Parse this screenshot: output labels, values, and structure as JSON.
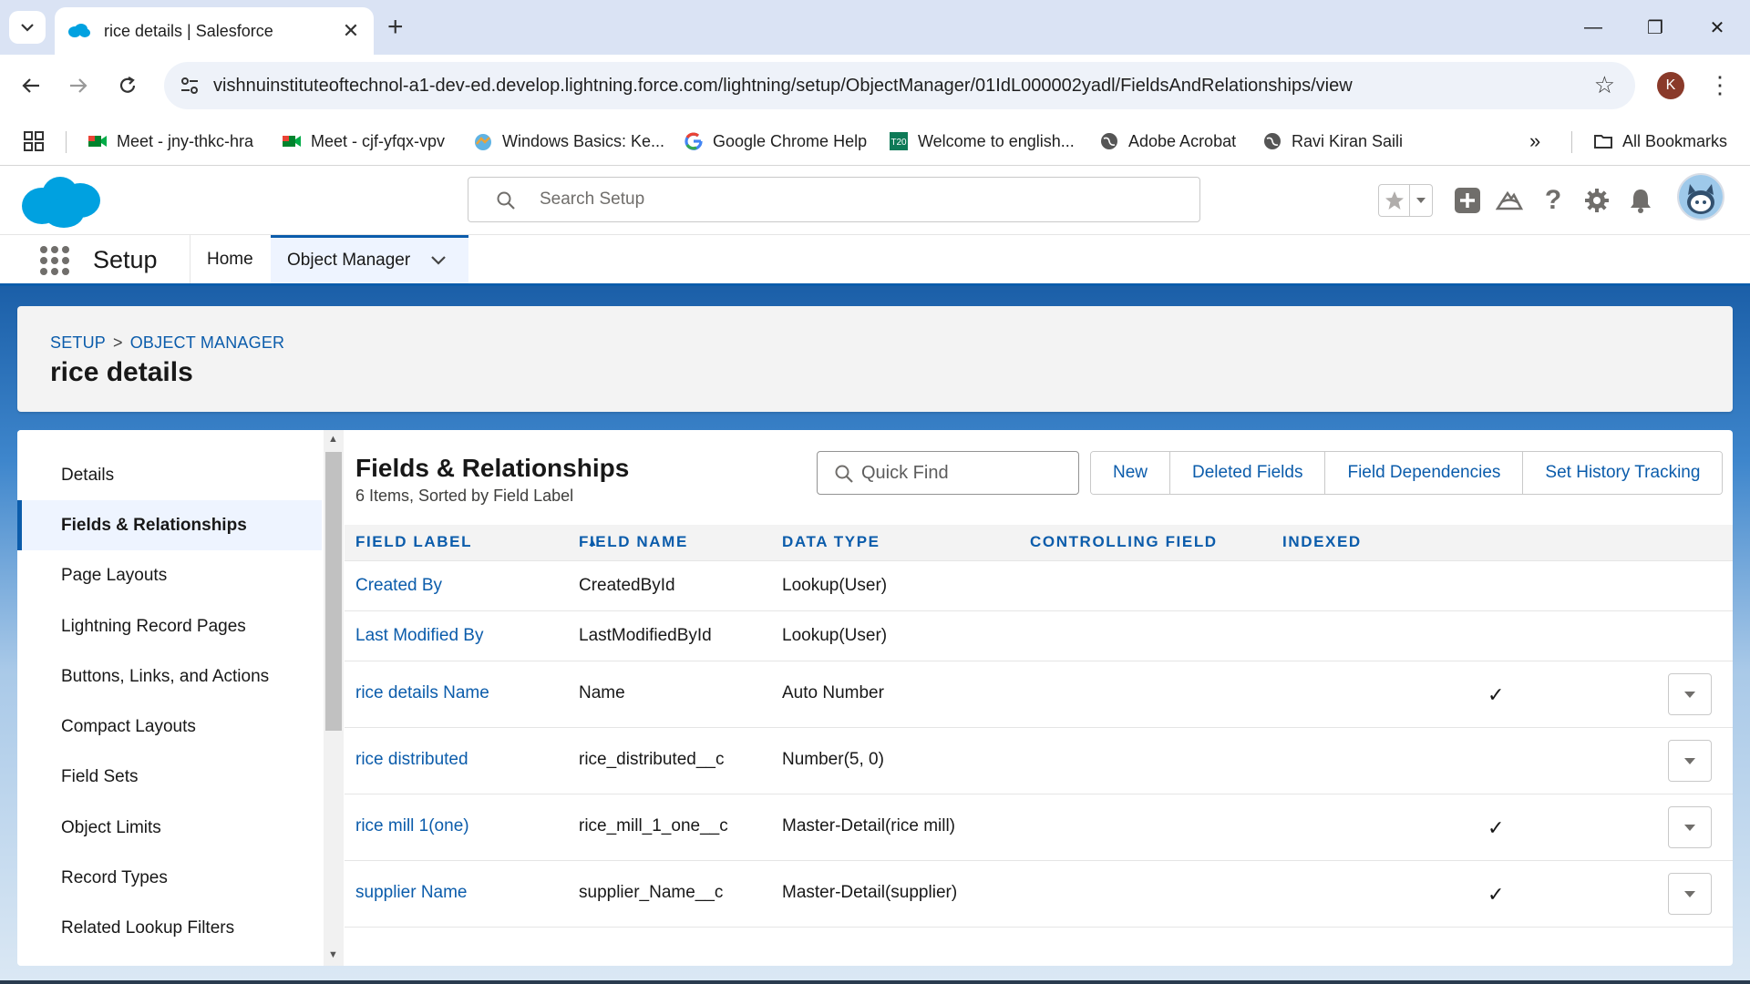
{
  "browser": {
    "tab_title": "rice details | Salesforce",
    "url": "vishnuinstituteoftechnol-a1-dev-ed.develop.lightning.force.com/lightning/setup/ObjectManager/01IdL000002yadl/FieldsAndRelationships/view",
    "profile_initial": "K",
    "bookmarks": [
      {
        "label": "Meet - jny-thkc-hra",
        "icon": "google-meet-icon"
      },
      {
        "label": "Meet - cjf-yfqx-vpv",
        "icon": "google-meet-icon"
      },
      {
        "label": "Windows Basics: Ke...",
        "icon": "trailhead-icon"
      },
      {
        "label": "Google Chrome Help",
        "icon": "google-icon"
      },
      {
        "label": "Welcome to english...",
        "icon": "t20-icon"
      },
      {
        "label": "Adobe Acrobat",
        "icon": "globe-icon"
      },
      {
        "label": "Ravi Kiran Saili",
        "icon": "globe-icon"
      }
    ],
    "all_bookmarks": "All Bookmarks",
    "more_bookmarks": "»"
  },
  "sf": {
    "search_placeholder": "Search Setup",
    "app_name": "Setup",
    "nav": {
      "home": "Home",
      "object_manager": "Object Manager"
    }
  },
  "page": {
    "breadcrumb": [
      "SETUP",
      "OBJECT MANAGER"
    ],
    "breadcrumb_sep": ">",
    "title": "rice details"
  },
  "sidebar": {
    "items": [
      {
        "label": "Details"
      },
      {
        "label": "Fields & Relationships",
        "active": true
      },
      {
        "label": "Page Layouts"
      },
      {
        "label": "Lightning Record Pages"
      },
      {
        "label": "Buttons, Links, and Actions"
      },
      {
        "label": "Compact Layouts"
      },
      {
        "label": "Field Sets"
      },
      {
        "label": "Object Limits"
      },
      {
        "label": "Record Types"
      },
      {
        "label": "Related Lookup Filters"
      }
    ]
  },
  "main": {
    "title": "Fields & Relationships",
    "subtitle": "6 Items, Sorted by Field Label",
    "quick_find_placeholder": "Quick Find",
    "buttons": {
      "new": "New",
      "deleted": "Deleted Fields",
      "dependencies": "Field Dependencies",
      "history": "Set History Tracking"
    },
    "columns": {
      "label": "FIELD LABEL",
      "name": "FIELD NAME",
      "type": "DATA TYPE",
      "controlling": "CONTROLLING FIELD",
      "indexed": "INDEXED"
    },
    "rows": [
      {
        "label": "Created By",
        "name": "CreatedById",
        "type": "Lookup(User)",
        "indexed": false,
        "menu": false
      },
      {
        "label": "Last Modified By",
        "name": "LastModifiedById",
        "type": "Lookup(User)",
        "indexed": false,
        "menu": false
      },
      {
        "label": "rice details Name",
        "name": "Name",
        "type": "Auto Number",
        "indexed": true,
        "menu": true
      },
      {
        "label": "rice distributed",
        "name": "rice_distributed__c",
        "type": "Number(5, 0)",
        "indexed": false,
        "menu": true
      },
      {
        "label": "rice mill 1(one)",
        "name": "rice_mill_1_one__c",
        "type": "Master-Detail(rice mill)",
        "indexed": true,
        "menu": true
      },
      {
        "label": "supplier Name",
        "name": "supplier_Name__c",
        "type": "Master-Detail(supplier)",
        "indexed": true,
        "menu": true
      }
    ]
  },
  "colors": {
    "brand_blue": "#0b5cab",
    "sf_cloud": "#00a1e0"
  }
}
